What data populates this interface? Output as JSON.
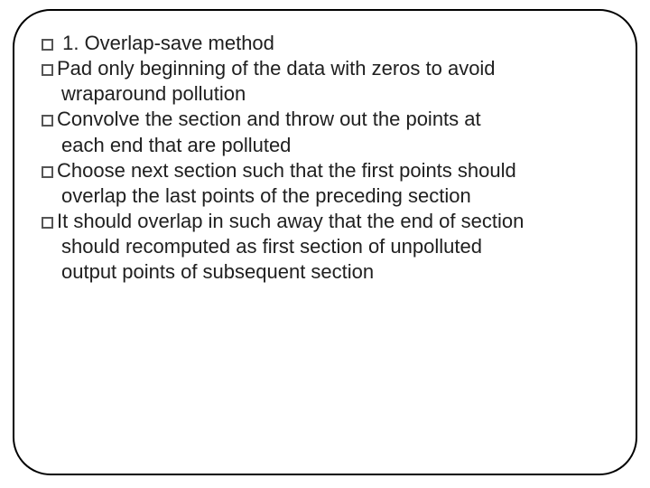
{
  "bullets": [
    {
      "first": " 1. Overlap-save method",
      "rest": []
    },
    {
      "first": "Pad only beginning of the data with zeros to avoid",
      "rest": [
        "wraparound pollution"
      ]
    },
    {
      "first": "Convolve the section and throw out the points at",
      "rest": [
        "each end that are polluted"
      ]
    },
    {
      "first": "Choose next section such that the first points should",
      "rest": [
        "overlap the last points of the preceding section"
      ]
    },
    {
      "first": "It should overlap in such away that the end of section",
      "rest": [
        "should recomputed as first  section of unpolluted",
        "output points of subsequent section"
      ]
    }
  ]
}
